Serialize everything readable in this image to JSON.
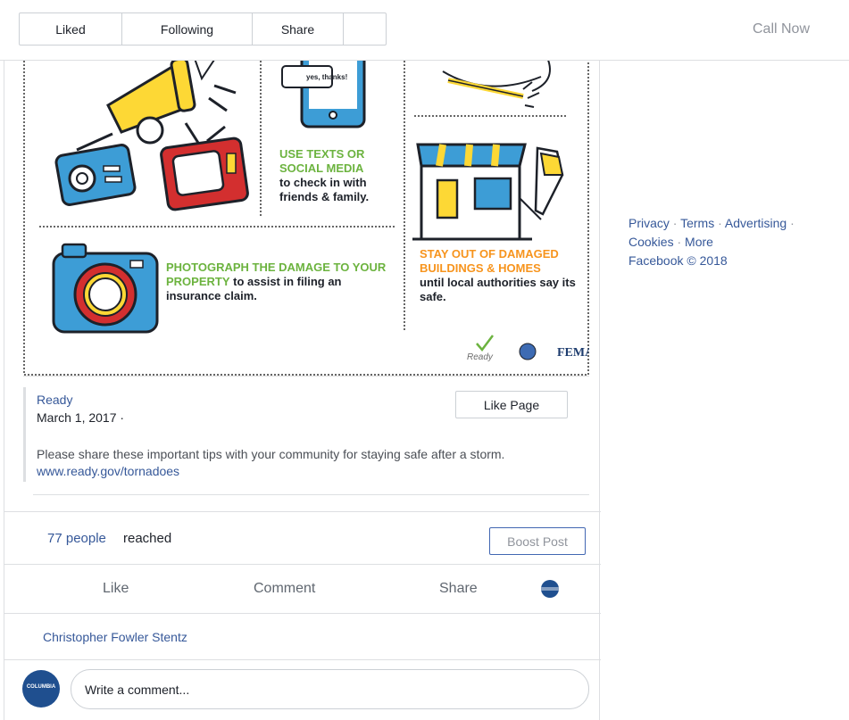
{
  "topbar": {
    "liked": "Liked",
    "following": "Following",
    "share": "Share",
    "call_now": "Call Now"
  },
  "infographic": {
    "bubble": "yes, thanks!",
    "texts_title": "USE TEXTS OR SOCIAL MEDIA",
    "texts_body": "to check in with friends & family.",
    "photo_title": "PHOTOGRAPH THE DAMAGE TO YOUR PROPERTY",
    "photo_body": "to assist in filing an insurance claim.",
    "stay_title": "STAY OUT OF DAMAGED BUILDINGS & HOMES",
    "stay_body": "until local authorities say its safe.",
    "ready_logo": "Ready",
    "fema_logo": "FEMA"
  },
  "shared_post": {
    "page_name": "Ready",
    "date": "March 1, 2017 ·",
    "like_page": "Like Page",
    "body": "Please share these important tips with your community for staying safe after a storm.",
    "link": "www.ready.gov/tornadoes"
  },
  "reach": {
    "count": "77 people",
    "label": "reached",
    "boost": "Boost Post"
  },
  "actions": {
    "like": "Like",
    "comment": "Comment",
    "share": "Share"
  },
  "commenter": {
    "name": "Christopher Fowler Stentz"
  },
  "composer": {
    "placeholder": "Write a comment...",
    "avatar_label": "COLUMBIA"
  },
  "footer": {
    "privacy": "Privacy",
    "terms": "Terms",
    "advertising": "Advertising",
    "cookies": "Cookies",
    "more": "More",
    "copyright": "Facebook © 2018",
    "separator": "·"
  },
  "colors": {
    "link": "#365899",
    "border": "#dddfe2",
    "ig_green": "#6cb33f",
    "ig_orange": "#f7941d",
    "ig_blue": "#3d9dd6",
    "ig_yellow": "#fdd835",
    "ig_red": "#d32f2f"
  }
}
